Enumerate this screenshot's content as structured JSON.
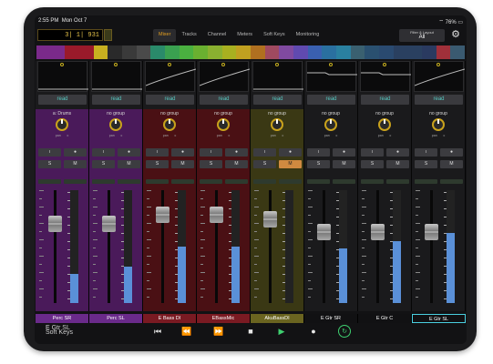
{
  "status": {
    "time": "2:55 PM",
    "date": "Mon Oct 7",
    "battery": "76%"
  },
  "counter": {
    "value": "3|   1|  931"
  },
  "tabs": [
    {
      "label": "Mixer",
      "active": true
    },
    {
      "label": "Tracks",
      "active": false
    },
    {
      "label": "Channel",
      "active": false
    },
    {
      "label": "Meters",
      "active": false
    },
    {
      "label": "Soft Keys",
      "active": false
    },
    {
      "label": "Monitoring",
      "active": false
    }
  ],
  "filter": {
    "label": "Filter & Layout",
    "value": "All"
  },
  "overview_colors": [
    "#7a2a8a",
    "#7a2a8a",
    "#9a1a2a",
    "#9a1a2a",
    "#c8b020",
    "#2a2a2a",
    "#3a3a3a",
    "#4a4a4a",
    "#2a8a6a",
    "#3aa050",
    "#4ab040",
    "#6ab030",
    "#8ab030",
    "#a8b020",
    "#c0a020",
    "#b07020",
    "#a04a60",
    "#804aa0",
    "#604ab0",
    "#3a60b0",
    "#2a70a0",
    "#2a80a0",
    "#3a6070",
    "#2a5070",
    "#2a4a70",
    "#2a4060",
    "#2a4060",
    "#2a3a60",
    "#a0303a",
    "#3a5a70"
  ],
  "strips": [
    {
      "name": "Perc SR",
      "group": "a: Drums",
      "read": "read",
      "color": "#4a1a5a",
      "name_color": "#6a2a8a",
      "fader": 0.7,
      "meter": 0.26,
      "auto": "flat"
    },
    {
      "name": "Perc SL",
      "group": "no group",
      "read": "read",
      "color": "#4a1a5a",
      "name_color": "#6a2a8a",
      "fader": 0.7,
      "meter": 0.32,
      "auto": "flat"
    },
    {
      "name": "E Bass DI",
      "group": "no group",
      "read": "read",
      "color": "#4a1014",
      "name_color": "#7a1a22",
      "fader": 0.78,
      "meter": 0.5,
      "auto": "ramp"
    },
    {
      "name": "EBassMic",
      "group": "no group",
      "read": "read",
      "color": "#4a1014",
      "name_color": "#7a1a22",
      "fader": 0.78,
      "meter": 0.5,
      "auto": "ramp"
    },
    {
      "name": "AkuBassDI",
      "group": "no group",
      "read": "read",
      "color": "#3a3814",
      "name_color": "#6a6420",
      "fader": 0.74,
      "meter": 0,
      "auto": "flat"
    },
    {
      "name": "E Gtr SR",
      "group": "no group",
      "read": "read",
      "color": "#1a1a1c",
      "name_color": "#111113",
      "fader": 0.63,
      "meter": 0.48,
      "auto": "step"
    },
    {
      "name": "E Gtr C",
      "group": "no group",
      "read": "read",
      "color": "#1a1a1c",
      "name_color": "#111113",
      "fader": 0.63,
      "meter": 0.55,
      "auto": "step"
    },
    {
      "name": "E Gtr SL",
      "group": "no group",
      "read": "read",
      "color": "#1a1a1c",
      "name_color": "#111113",
      "fader": 0.63,
      "meter": 0.62,
      "auto": "ramp"
    }
  ],
  "selected_track": "E Gtr SL",
  "soft_keys": "Soft Keys",
  "transport": {
    "icons": [
      "rewind-start-icon",
      "rewind-icon",
      "fast-forward-icon",
      "stop-icon",
      "play-icon",
      "record-icon",
      "loop-icon"
    ]
  }
}
